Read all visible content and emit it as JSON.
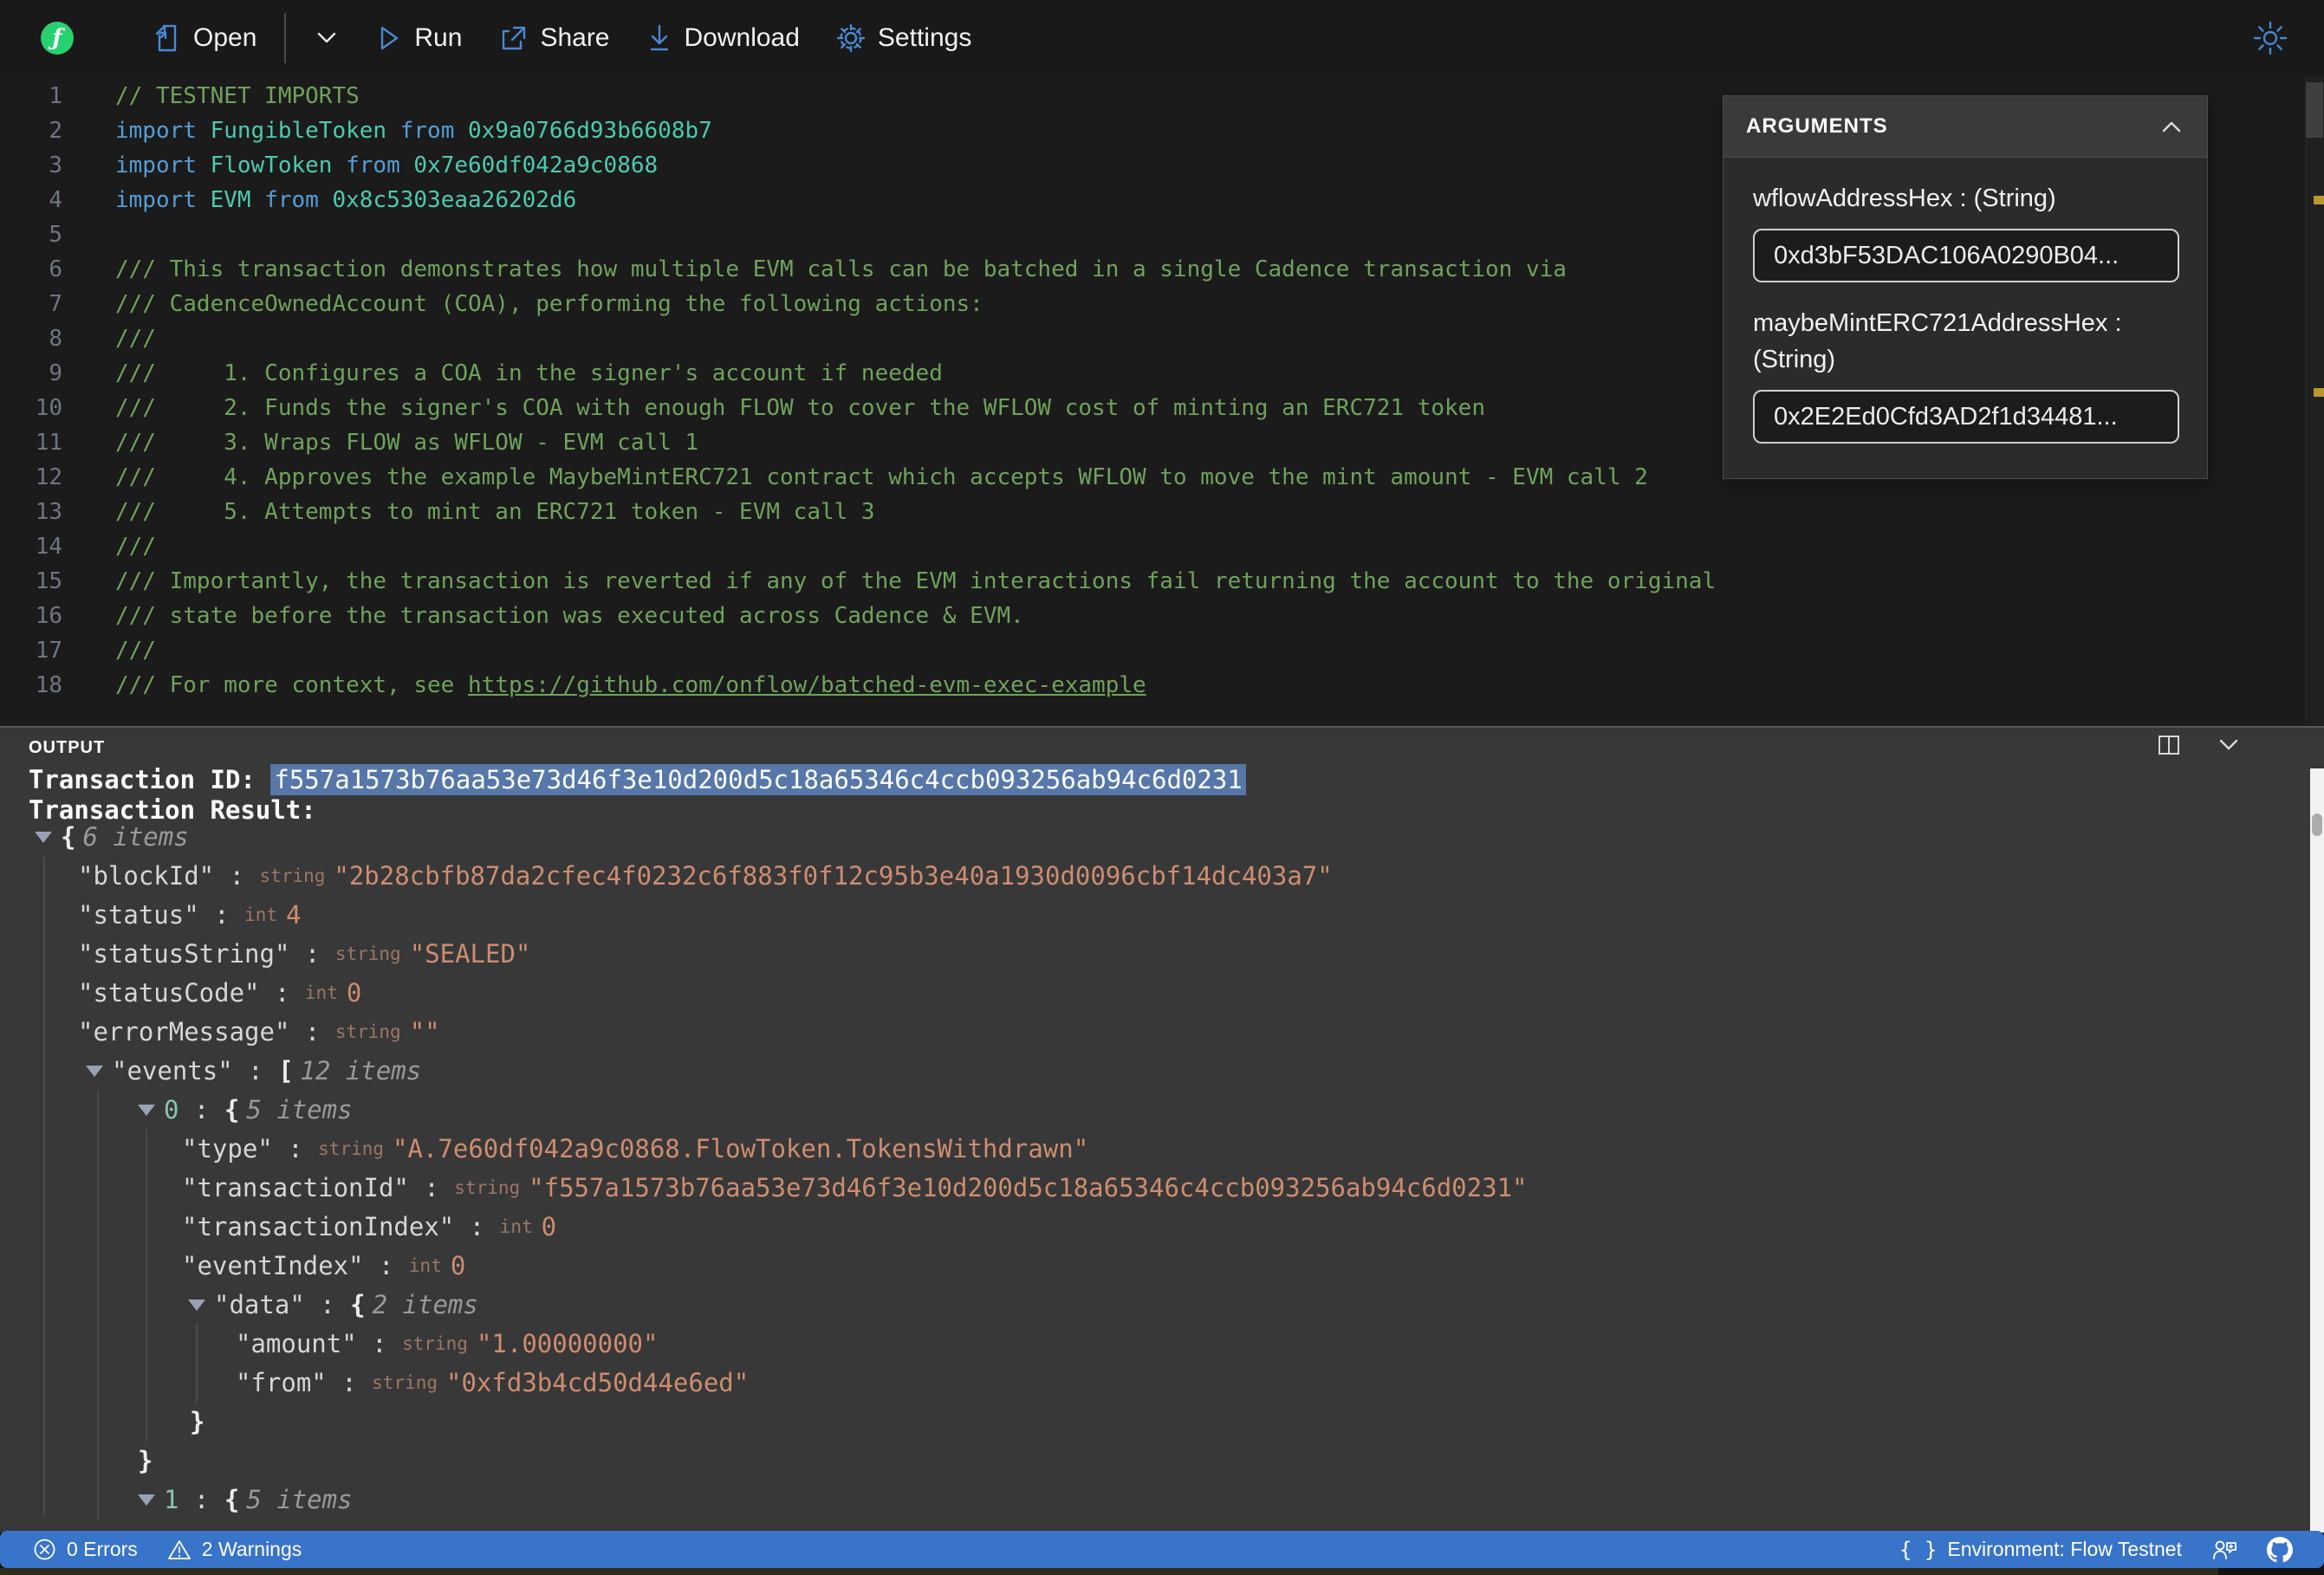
{
  "toolbar": {
    "open": "Open",
    "run": "Run",
    "share": "Share",
    "download": "Download",
    "settings": "Settings"
  },
  "editor": {
    "lines": [
      {
        "n": "1",
        "tokens": [
          [
            "cm",
            "// TESTNET IMPORTS"
          ]
        ]
      },
      {
        "n": "2",
        "tokens": [
          [
            "kw",
            "import "
          ],
          [
            "ty",
            "FungibleToken "
          ],
          [
            "kw",
            "from "
          ],
          [
            "ty",
            "0x9a0766d93b6608b7"
          ]
        ]
      },
      {
        "n": "3",
        "tokens": [
          [
            "kw",
            "import "
          ],
          [
            "ty",
            "FlowToken "
          ],
          [
            "kw",
            "from "
          ],
          [
            "ty",
            "0x7e60df042a9c0868"
          ]
        ]
      },
      {
        "n": "4",
        "tokens": [
          [
            "kw",
            "import "
          ],
          [
            "ty",
            "EVM "
          ],
          [
            "kw",
            "from "
          ],
          [
            "ty",
            "0x8c5303eaa26202d6"
          ]
        ]
      },
      {
        "n": "5",
        "tokens": []
      },
      {
        "n": "6",
        "tokens": [
          [
            "cm",
            "/// This transaction demonstrates how multiple EVM calls can be batched in a single Cadence transaction via"
          ]
        ]
      },
      {
        "n": "7",
        "tokens": [
          [
            "cm",
            "/// CadenceOwnedAccount (COA), performing the following actions:"
          ]
        ]
      },
      {
        "n": "8",
        "tokens": [
          [
            "cm",
            "///"
          ]
        ]
      },
      {
        "n": "9",
        "tokens": [
          [
            "cm",
            "///     1. Configures a COA in the signer's account if needed"
          ]
        ]
      },
      {
        "n": "10",
        "tokens": [
          [
            "cm",
            "///     2. Funds the signer's COA with enough FLOW to cover the WFLOW cost of minting an ERC721 token"
          ]
        ]
      },
      {
        "n": "11",
        "tokens": [
          [
            "cm",
            "///     3. Wraps FLOW as WFLOW - EVM call 1"
          ]
        ]
      },
      {
        "n": "12",
        "tokens": [
          [
            "cm",
            "///     4. Approves the example MaybeMintERC721 contract which accepts WFLOW to move the mint amount - EVM call 2"
          ]
        ]
      },
      {
        "n": "13",
        "tokens": [
          [
            "cm",
            "///     5. Attempts to mint an ERC721 token - EVM call 3"
          ]
        ]
      },
      {
        "n": "14",
        "tokens": [
          [
            "cm",
            "///"
          ]
        ]
      },
      {
        "n": "15",
        "tokens": [
          [
            "cm",
            "/// Importantly, the transaction is reverted if any of the EVM interactions fail returning the account to the original"
          ]
        ]
      },
      {
        "n": "16",
        "tokens": [
          [
            "cm",
            "/// state before the transaction was executed across Cadence & EVM."
          ]
        ]
      },
      {
        "n": "17",
        "tokens": [
          [
            "cm",
            "///"
          ]
        ]
      },
      {
        "n": "18",
        "tokens": [
          [
            "cm",
            "/// For more context, see "
          ],
          [
            "ln",
            "https://github.com/onflow/batched-evm-exec-example"
          ]
        ]
      }
    ]
  },
  "arguments_panel": {
    "title": "ARGUMENTS",
    "args": [
      {
        "label": "wflowAddressHex : (String)",
        "value": "0xd3bF53DAC106A0290B04..."
      },
      {
        "label": "maybeMintERC721AddressHex : (String)",
        "value": "0x2E2Ed0Cfd3AD2f1d34481..."
      }
    ]
  },
  "output": {
    "title": "OUTPUT",
    "tx_id_label": "Transaction ID: ",
    "tx_id": "f557a1573b76aa53e73d46f3e10d200d5c18a65346c4ccb093256ab94c6d0231",
    "result_label": "Transaction Result:",
    "rows": [
      {
        "ind": 40,
        "seg": [
          [
            "arrow",
            ""
          ],
          [
            "brace",
            "{"
          ],
          [
            "items",
            "6 items"
          ]
        ]
      },
      {
        "ind": 90,
        "seg": [
          [
            "key",
            "\"blockId\""
          ],
          [
            "sep",
            " : "
          ],
          [
            "type",
            "string"
          ],
          [
            "str",
            "\"2b28cbfb87da2cfec4f0232c6f883f0f12c95b3e40a1930d0096cbf14dc403a7\""
          ]
        ]
      },
      {
        "ind": 90,
        "seg": [
          [
            "key",
            "\"status\""
          ],
          [
            "sep",
            " : "
          ],
          [
            "type",
            "int"
          ],
          [
            "str",
            "4"
          ]
        ]
      },
      {
        "ind": 90,
        "seg": [
          [
            "key",
            "\"statusString\""
          ],
          [
            "sep",
            " : "
          ],
          [
            "type",
            "string"
          ],
          [
            "str",
            "\"SEALED\""
          ]
        ]
      },
      {
        "ind": 90,
        "seg": [
          [
            "key",
            "\"statusCode\""
          ],
          [
            "sep",
            " : "
          ],
          [
            "type",
            "int"
          ],
          [
            "str",
            "0"
          ]
        ]
      },
      {
        "ind": 90,
        "seg": [
          [
            "key",
            "\"errorMessage\""
          ],
          [
            "sep",
            " : "
          ],
          [
            "type",
            "string"
          ],
          [
            "str",
            "\"\""
          ]
        ]
      },
      {
        "ind": 99,
        "seg": [
          [
            "arrow",
            ""
          ],
          [
            "key",
            "\"events\""
          ],
          [
            "sep",
            " : "
          ],
          [
            "brace",
            "["
          ],
          [
            "items",
            "12 items"
          ]
        ]
      },
      {
        "ind": 159,
        "seg": [
          [
            "arrow",
            ""
          ],
          [
            "idx",
            "0"
          ],
          [
            "sep",
            " : "
          ],
          [
            "brace",
            "{"
          ],
          [
            "items",
            "5 items"
          ]
        ]
      },
      {
        "ind": 210,
        "seg": [
          [
            "key",
            "\"type\""
          ],
          [
            "sep",
            " : "
          ],
          [
            "type",
            "string"
          ],
          [
            "str",
            "\"A.7e60df042a9c0868.FlowToken.TokensWithdrawn\""
          ]
        ]
      },
      {
        "ind": 210,
        "seg": [
          [
            "key",
            "\"transactionId\""
          ],
          [
            "sep",
            " : "
          ],
          [
            "type",
            "string"
          ],
          [
            "str",
            "\"f557a1573b76aa53e73d46f3e10d200d5c18a65346c4ccb093256ab94c6d0231\""
          ]
        ]
      },
      {
        "ind": 210,
        "seg": [
          [
            "key",
            "\"transactionIndex\""
          ],
          [
            "sep",
            " : "
          ],
          [
            "type",
            "int"
          ],
          [
            "str",
            "0"
          ]
        ]
      },
      {
        "ind": 210,
        "seg": [
          [
            "key",
            "\"eventIndex\""
          ],
          [
            "sep",
            " : "
          ],
          [
            "type",
            "int"
          ],
          [
            "str",
            "0"
          ]
        ]
      },
      {
        "ind": 217,
        "seg": [
          [
            "arrow",
            ""
          ],
          [
            "key",
            "\"data\""
          ],
          [
            "sep",
            " : "
          ],
          [
            "brace",
            "{"
          ],
          [
            "items",
            "2 items"
          ]
        ]
      },
      {
        "ind": 272,
        "seg": [
          [
            "key",
            "\"amount\""
          ],
          [
            "sep",
            " : "
          ],
          [
            "type",
            "string"
          ],
          [
            "str",
            "\"1.00000000\""
          ]
        ]
      },
      {
        "ind": 272,
        "seg": [
          [
            "key",
            "\"from\""
          ],
          [
            "sep",
            " : "
          ],
          [
            "type",
            "string"
          ],
          [
            "str",
            "\"0xfd3b4cd50d44e6ed\""
          ]
        ]
      },
      {
        "ind": 219,
        "seg": [
          [
            "brace",
            "}"
          ]
        ]
      },
      {
        "ind": 159,
        "seg": [
          [
            "brace",
            "}"
          ]
        ]
      },
      {
        "ind": 159,
        "seg": [
          [
            "arrow",
            ""
          ],
          [
            "idx",
            "1"
          ],
          [
            "sep",
            " : "
          ],
          [
            "brace",
            "{"
          ],
          [
            "items",
            "5 items"
          ]
        ]
      }
    ]
  },
  "status_bar": {
    "errors": "0 Errors",
    "warnings": "2 Warnings",
    "environment": "Environment: Flow Testnet"
  },
  "colors": {
    "accent_blue": "#4b87d2",
    "status_bar": "#3874c9",
    "flow_green": "#27d170",
    "selection": "#5677a8",
    "comment_green": "#6fa25c",
    "keyword_blue": "#569CD6",
    "type_teal": "#4EC9B0",
    "json_string": "#cd8d70"
  }
}
